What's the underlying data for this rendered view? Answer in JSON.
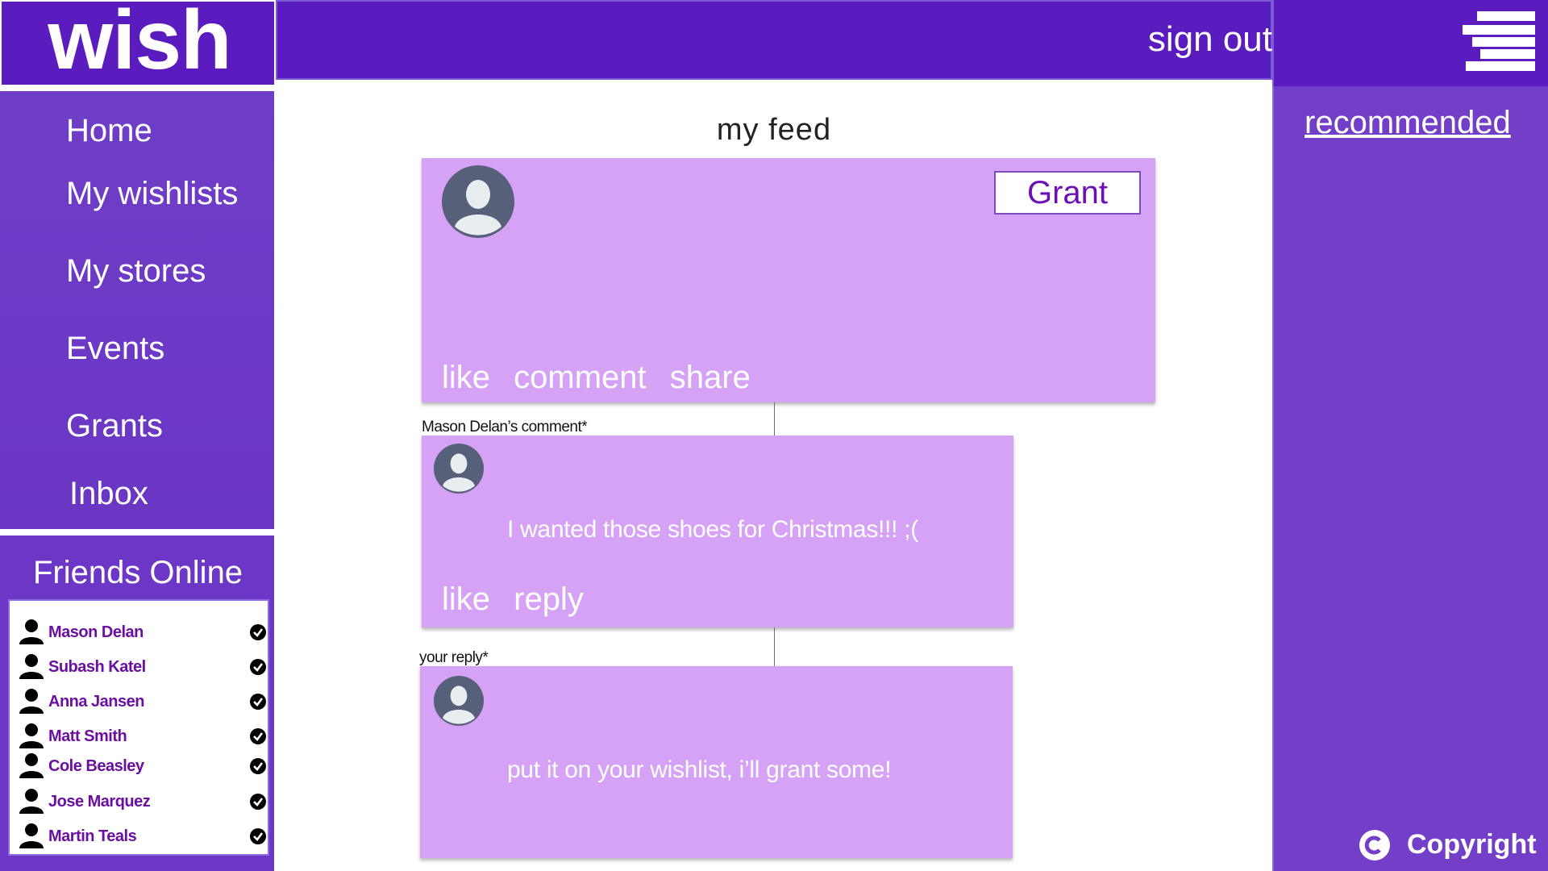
{
  "app": {
    "logo": "wish",
    "sign_out": "sign out",
    "menu_icon": "hamburger-menu-icon"
  },
  "nav": {
    "items": [
      {
        "label": "Home"
      },
      {
        "label": "My wishlists"
      },
      {
        "label": "My stores"
      },
      {
        "label": "Events"
      },
      {
        "label": "Grants"
      },
      {
        "label": "Inbox"
      }
    ]
  },
  "friends": {
    "title": "Friends Online",
    "list": [
      {
        "name": "Mason Delan",
        "status": "online"
      },
      {
        "name": "Subash Katel",
        "status": "online"
      },
      {
        "name": "Anna Jansen",
        "status": "online"
      },
      {
        "name": "Matt Smith",
        "status": "online"
      },
      {
        "name": "Cole Beasley",
        "status": "online"
      },
      {
        "name": "Jose Marquez",
        "status": "online"
      },
      {
        "name": "Martin Teals",
        "status": "online"
      }
    ]
  },
  "feed": {
    "title": "my feed",
    "post": {
      "badge": "Grant",
      "actions": [
        "like",
        "comment",
        "share"
      ]
    },
    "comment": {
      "label": "Mason Delan’s comment*",
      "text": "I wanted those shoes for Christmas!!! ;(",
      "actions": [
        "like",
        "reply"
      ]
    },
    "reply": {
      "label": "your reply*",
      "text": "put it on your wishlist, i’ll grant some!"
    }
  },
  "right": {
    "recommended": "recommended",
    "copyright": "Copyright"
  },
  "colors": {
    "brand_purple": "#5a1bbf",
    "nav_purple": "#6f3ec8",
    "card_lilac": "#d6a2f5",
    "friend_name": "#6a0fa0",
    "grant_text": "#6d0fb5"
  }
}
